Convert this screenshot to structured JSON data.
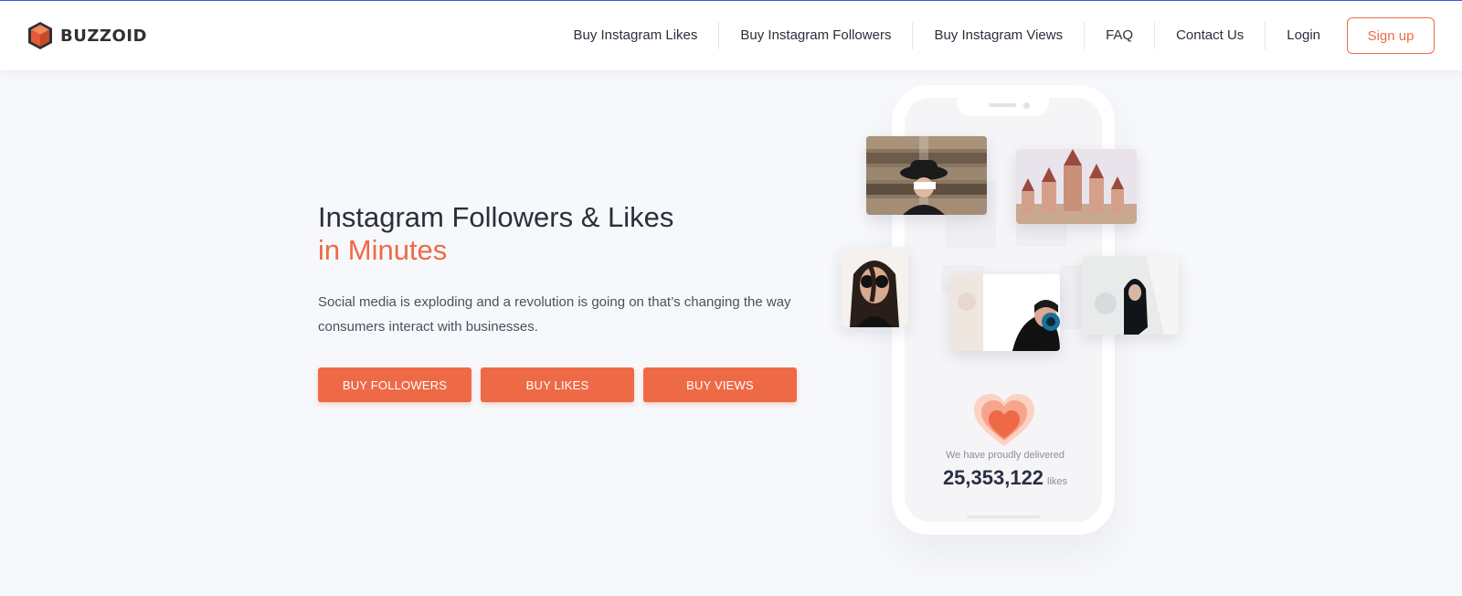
{
  "brand": {
    "name": "BUZZOID",
    "accent_color": "#ef6a47"
  },
  "nav": {
    "items": [
      {
        "label": "Buy Instagram Likes"
      },
      {
        "label": "Buy Instagram Followers"
      },
      {
        "label": "Buy Instagram Views"
      },
      {
        "label": "FAQ"
      },
      {
        "label": "Contact Us"
      },
      {
        "label": "Login"
      }
    ],
    "signup_label": "Sign up"
  },
  "hero": {
    "title": "Instagram Followers & Likes",
    "title_accent": "in Minutes",
    "description": "Social media is exploding and a revolution is going on that’s changing the way consumers interact with businesses.",
    "buttons": [
      {
        "label": "BUY FOLLOWERS"
      },
      {
        "label": "BUY LIKES"
      },
      {
        "label": "BUY VIEWS"
      }
    ]
  },
  "phone": {
    "delivered_text": "We have proudly delivered",
    "count": "25,353,122",
    "count_unit": "likes",
    "icon": "heart-icon"
  },
  "photos": [
    {
      "name": "photo-woman-wood-wall"
    },
    {
      "name": "photo-castle"
    },
    {
      "name": "photo-woman-sunglasses"
    },
    {
      "name": "photo-woman-eye"
    },
    {
      "name": "photo-woman-balloon"
    }
  ]
}
